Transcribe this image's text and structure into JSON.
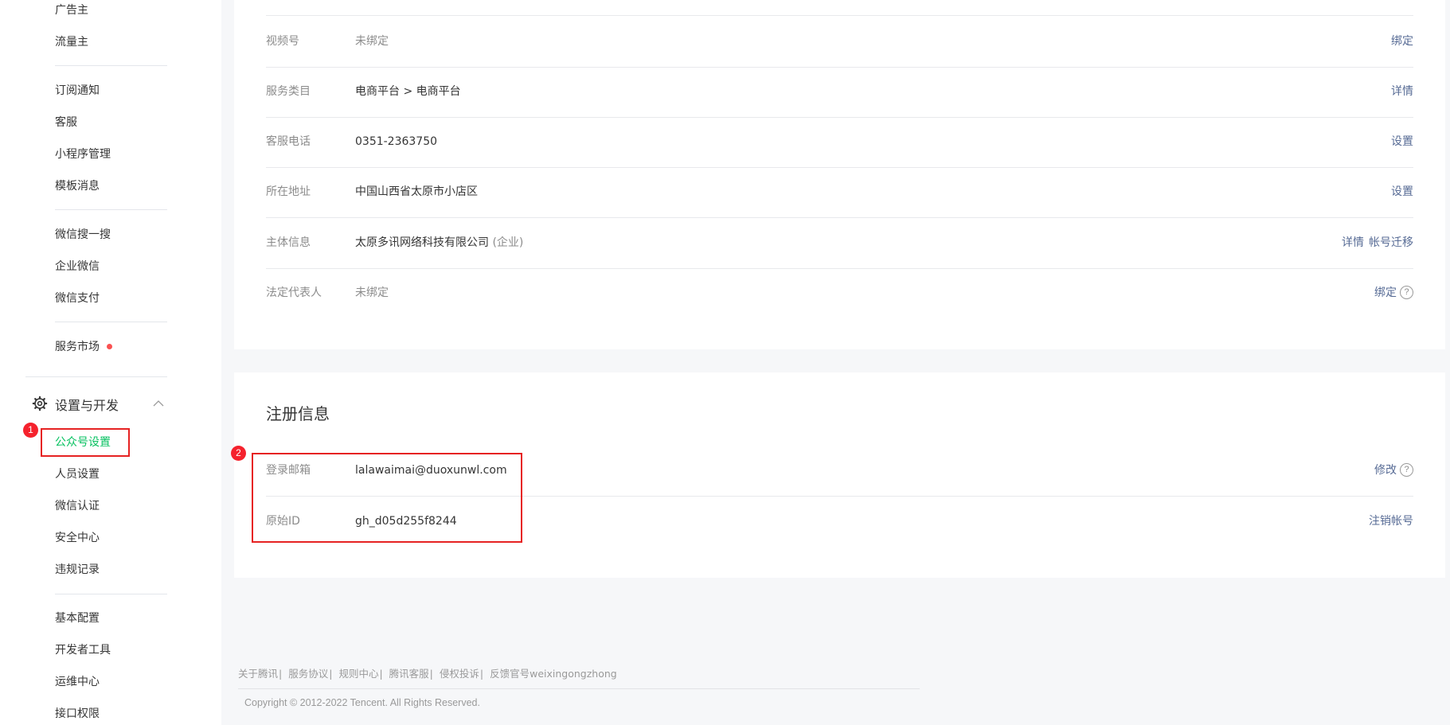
{
  "sidebar": {
    "group_top": [
      "广告主",
      "流量主"
    ],
    "group_2": [
      "订阅通知",
      "客服",
      "小程序管理",
      "模板消息"
    ],
    "group_3": [
      "微信搜一搜",
      "企业微信",
      "微信支付"
    ],
    "market": "服务市场",
    "section": {
      "label": "设置与开发",
      "icon": "gear-icon"
    },
    "group_settings": [
      "公众号设置",
      "人员设置",
      "微信认证",
      "安全中心",
      "违规记录"
    ],
    "group_dev": [
      "基本配置",
      "开发者工具",
      "运维中心",
      "接口权限"
    ],
    "active_item": "公众号设置"
  },
  "annotations": {
    "badge1": "1",
    "badge2": "2",
    "highlight_color": "#e62222"
  },
  "info_rows": [
    {
      "label": "视频号",
      "value": "未绑定",
      "actions": [
        "绑定"
      ]
    },
    {
      "label": "服务类目",
      "value": "电商平台 > 电商平台",
      "actions": [
        "详情"
      ]
    },
    {
      "label": "客服电话",
      "value": "0351-2363750",
      "actions": [
        "设置"
      ]
    },
    {
      "label": "所在地址",
      "value": "中国山西省太原市小店区",
      "actions": [
        "设置"
      ]
    },
    {
      "label": "主体信息",
      "value": "太原多讯网络科技有限公司",
      "value_note": "(企业)",
      "actions": [
        "详情",
        "帐号迁移"
      ]
    },
    {
      "label": "法定代表人",
      "value": "未绑定",
      "actions": [
        "绑定"
      ]
    }
  ],
  "registration": {
    "title": "注册信息",
    "rows": [
      {
        "label": "登录邮箱",
        "value": "lalawaimai@duoxunwl.com",
        "actions": [
          "修改"
        ]
      },
      {
        "label": "原始ID",
        "value": "gh_d05d255f8244",
        "actions": [
          "注销帐号"
        ]
      }
    ]
  },
  "help_glyph": "?",
  "footer": {
    "links": [
      "关于腾讯",
      "服务协议",
      "规则中心",
      "腾讯客服",
      "侵权投诉",
      "反馈官号weixingongzhong"
    ],
    "separator": "|",
    "copyright": "Copyright © 2012-2022 Tencent. All Rights Reserved."
  },
  "colors": {
    "accent": "#07c160",
    "link": "#576b95",
    "alert": "#fa5151"
  }
}
